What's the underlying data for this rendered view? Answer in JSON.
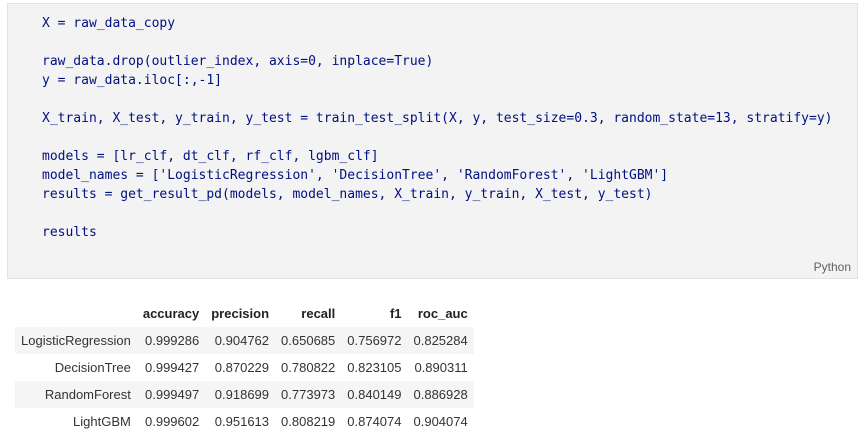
{
  "cell": {
    "language": "Python",
    "code_lines": [
      "X = raw_data_copy",
      "",
      "raw_data.drop(outlier_index, axis=0, inplace=True)",
      "y = raw_data.iloc[:,-1]",
      "",
      "X_train, X_test, y_train, y_test = train_test_split(X, y, test_size=0.3, random_state=13, stratify=y)",
      "",
      "models = [lr_clf, dt_clf, rf_clf, lgbm_clf]",
      "model_names = ['LogisticRegression', 'DecisionTree', 'RandomForest', 'LightGBM']",
      "results = get_result_pd(models, model_names, X_train, y_train, X_test, y_test)",
      "",
      "results"
    ]
  },
  "output": {
    "columns": [
      "accuracy",
      "precision",
      "recall",
      "f1",
      "roc_auc"
    ],
    "rows": [
      {
        "index": "LogisticRegression",
        "values": [
          "0.999286",
          "0.904762",
          "0.650685",
          "0.756972",
          "0.825284"
        ]
      },
      {
        "index": "DecisionTree",
        "values": [
          "0.999427",
          "0.870229",
          "0.780822",
          "0.823105",
          "0.890311"
        ]
      },
      {
        "index": "RandomForest",
        "values": [
          "0.999497",
          "0.918699",
          "0.773973",
          "0.840149",
          "0.886928"
        ]
      },
      {
        "index": "LightGBM",
        "values": [
          "0.999602",
          "0.951613",
          "0.808219",
          "0.874074",
          "0.904074"
        ]
      }
    ]
  }
}
